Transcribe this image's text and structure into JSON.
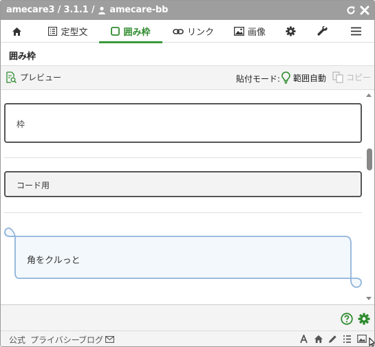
{
  "window": {
    "title_prefix": "amecare3 / 3.1.1 /",
    "title_user": "amecare-bb"
  },
  "tabs": [
    {
      "label": "",
      "icon": "home-icon"
    },
    {
      "label": "定型文",
      "icon": "list-icon"
    },
    {
      "label": "囲み枠",
      "icon": "square-icon",
      "active": true
    },
    {
      "label": "リンク",
      "icon": "link-icon"
    },
    {
      "label": "画像",
      "icon": "image-icon"
    },
    {
      "label": "",
      "icon": "gear-icon"
    },
    {
      "label": "",
      "icon": "wrench-icon"
    },
    {
      "label": "",
      "icon": "menu-icon"
    }
  ],
  "section": {
    "title": "囲み枠"
  },
  "toolbar": {
    "preview_label": "プレビュー",
    "paste_mode_label": "貼付モード:",
    "paste_mode_value": "範囲自動",
    "copy_label": "コピー"
  },
  "items": [
    {
      "label": "枠",
      "style": "frame"
    },
    {
      "label": "コード用",
      "style": "code"
    },
    {
      "label": "角をクルっと",
      "style": "curl"
    }
  ],
  "footer": {
    "links": [
      "公式",
      "プライバシー",
      "ブログ"
    ]
  },
  "colors": {
    "accent": "#2e8b2e",
    "titlebar": "#9e9e9e",
    "curl_border": "#8fb3d9",
    "curl_fill": "#f3f8fd"
  }
}
